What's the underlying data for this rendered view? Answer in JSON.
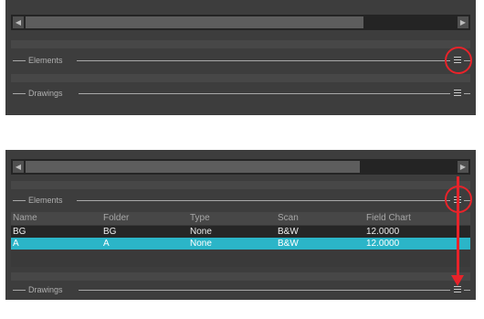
{
  "scrollbar": {
    "left_arrow": "◀",
    "right_arrow": "▶"
  },
  "dividers": {
    "elements_label": "Elements",
    "drawings_label": "Drawings"
  },
  "elements_table": {
    "columns": [
      "Name",
      "Folder",
      "Type",
      "Scan",
      "Field Chart"
    ],
    "rows": [
      {
        "name": "BG",
        "folder": "BG",
        "type": "None",
        "scan": "B&W",
        "field_chart": "12.0000",
        "selected": false
      },
      {
        "name": "A",
        "folder": "A",
        "type": "None",
        "scan": "B&W",
        "field_chart": "12.0000",
        "selected": true
      }
    ]
  },
  "colors": {
    "panel_bg": "#3d3d3d",
    "selection": "#2bb5c8",
    "annotation": "#e8232a"
  },
  "icons": {
    "scroll_left": "scroll-left-arrow-icon",
    "scroll_right": "scroll-right-arrow-icon",
    "splitter_handle": "splitter-grip-icon",
    "highlight": "red-circle-highlight",
    "drag_arrow": "red-down-arrow"
  }
}
